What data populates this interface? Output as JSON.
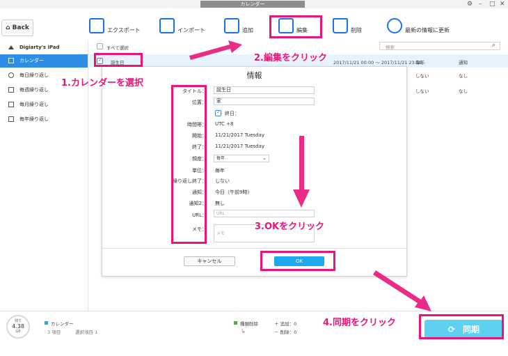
{
  "window": {
    "title": "カレンダー",
    "controls": [
      "⚙",
      "–",
      "□",
      "✕"
    ]
  },
  "toolbar": {
    "back_label": "Back",
    "items": [
      {
        "label": "エクスポート",
        "icon": "export-icon"
      },
      {
        "label": "インポート",
        "icon": "import-icon"
      },
      {
        "label": "追加",
        "icon": "add-icon"
      },
      {
        "label": "編集",
        "icon": "edit-icon"
      },
      {
        "label": "削除",
        "icon": "trash-icon"
      },
      {
        "label": "最新の情報に更新",
        "icon": "refresh-icon"
      }
    ]
  },
  "sidebar": {
    "device": "Digiarty's iPad",
    "items": [
      {
        "label": "カレンダー",
        "icon": "calendar-icon",
        "active": true
      },
      {
        "label": "毎日繰り返し",
        "icon": "daily-icon"
      },
      {
        "label": "毎週繰り返し",
        "icon": "weekly-icon"
      },
      {
        "label": "毎月繰り返し",
        "icon": "monthly-icon"
      },
      {
        "label": "毎年繰り返し",
        "icon": "yearly-icon"
      }
    ]
  },
  "list": {
    "select_all": "すべて選択",
    "search_placeholder": "検索",
    "rows": [
      {
        "title": "誕生日",
        "time": "2017/11/21 00:00 ～ 2017/11/21 23:59",
        "repeat": "毎年",
        "alert": "通知"
      },
      {
        "title": "",
        "time": "",
        "repeat": "しない",
        "alert": "なし"
      },
      {
        "title": "",
        "time": "",
        "repeat": "しない",
        "alert": "なし"
      }
    ]
  },
  "modal": {
    "title": "情報",
    "fields": {
      "title_label": "タイトル：",
      "title_value": "誕生日",
      "location_label": "位置：",
      "location_value": "家",
      "allday_label": "終日：",
      "timezone_label": "時間帯：",
      "timezone_value": "UTC +8",
      "start_label": "開始：",
      "start_value": "11/21/2017   Tuesday",
      "end_label": "終了：",
      "end_value": "11/21/2017   Tuesday",
      "frequency_label": "頻度：",
      "frequency_value": "毎年",
      "unit_label": "単位：",
      "unit_value": "毎年",
      "repeat_end_label": "繰り返し終了：",
      "repeat_end_value": "しない",
      "alert_label": "通知：",
      "alert_value": "今日（午前9時）",
      "alert2_label": "通知2：",
      "alert2_value": "無し",
      "url_label": "URL：",
      "url_placeholder": "URL",
      "memo_label": "メモ：",
      "memo_placeholder": "メモ"
    },
    "cancel_label": "キャンセル",
    "ok_label": "OK"
  },
  "bottom": {
    "storage_caption": "残り",
    "storage_value": "4.38",
    "storage_unit": "GB",
    "category": "カレンダー",
    "items_count": "3 項目",
    "selected_count": "選択項目 1",
    "delete_label": "種類削除",
    "add_label": "＋ 追加：0",
    "del_label": "－ 削除：0",
    "sync_label": "同期"
  },
  "annotations": {
    "step1": "1.カレンダーを選択",
    "step2": "2.編集をクリック",
    "step3": "3.OKをクリック",
    "step4": "4.同期をクリック"
  },
  "colors": {
    "accent": "#2e8ee3",
    "annotation": "#e8157a",
    "ok_button": "#1ea8ef",
    "sync_button": "#5fd0f0"
  }
}
